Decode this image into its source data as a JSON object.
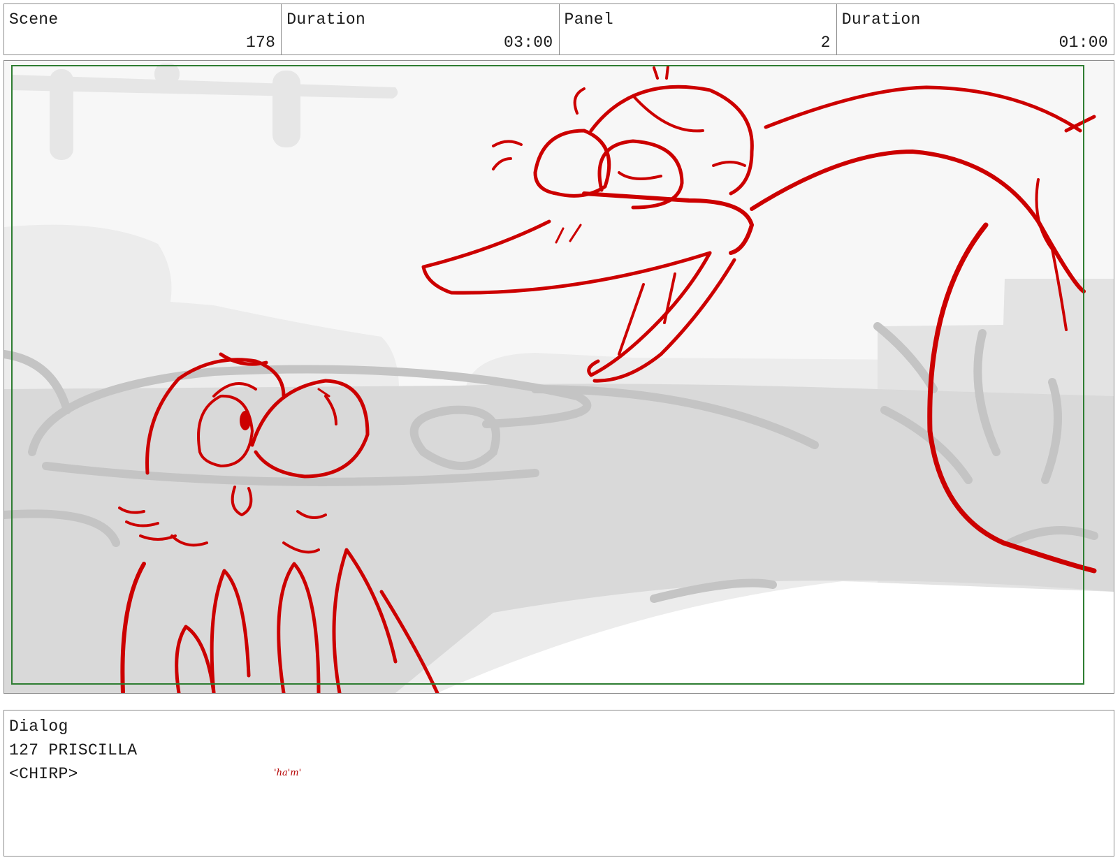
{
  "header": {
    "cells": [
      {
        "label": "Scene",
        "value": "178"
      },
      {
        "label": "Duration",
        "value": "03:00"
      },
      {
        "label": "Panel",
        "value": "2"
      },
      {
        "label": "Duration",
        "value": "01:00"
      }
    ]
  },
  "panel": {
    "safe_frame_color": "#2e7d32",
    "line_color": "#cc0000",
    "background_color": "#d9d9d9",
    "sky_color": "#f7f7f7"
  },
  "dialog": {
    "lines": [
      "Dialog",
      "127 PRISCILLA",
      "<CHIRP>"
    ],
    "scribble": "'ha'm'"
  }
}
